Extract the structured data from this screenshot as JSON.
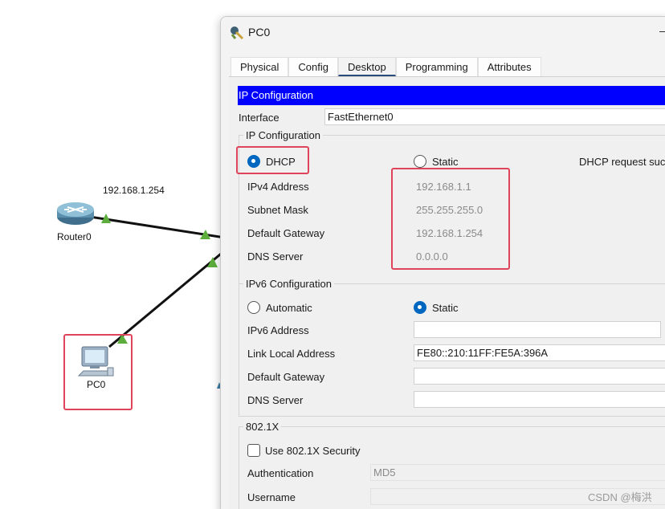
{
  "topology": {
    "router_label": "Router0",
    "router_ip_label": "192.168.1.254",
    "pc_label": "PC0",
    "link_color": "#111111",
    "link_light_color": "#5cad3c",
    "highlight_color": "#e0445a"
  },
  "window": {
    "title": "PC0",
    "tabs": [
      {
        "label": "Physical",
        "active": false
      },
      {
        "label": "Config",
        "active": false
      },
      {
        "label": "Desktop",
        "active": true
      },
      {
        "label": "Programming",
        "active": false
      },
      {
        "label": "Attributes",
        "active": false
      }
    ]
  },
  "ip_config": {
    "header": "IP Configuration",
    "interface_label": "Interface",
    "interface_value": "FastEthernet0",
    "ipv4": {
      "group_title": "IP Configuration",
      "dhcp_label": "DHCP",
      "static_label": "Static",
      "mode": "DHCP",
      "status_text": "DHCP request suc",
      "fields": [
        {
          "label": "IPv4 Address",
          "value": "192.168.1.1"
        },
        {
          "label": "Subnet Mask",
          "value": "255.255.255.0"
        },
        {
          "label": "Default Gateway",
          "value": "192.168.1.254"
        },
        {
          "label": "DNS Server",
          "value": "0.0.0.0"
        }
      ]
    },
    "ipv6": {
      "group_title": "IPv6 Configuration",
      "automatic_label": "Automatic",
      "static_label": "Static",
      "mode": "Static",
      "fields": [
        {
          "label": "IPv6 Address",
          "value": ""
        },
        {
          "label": "Link Local Address",
          "value": "FE80::210:11FF:FE5A:396A"
        },
        {
          "label": "Default Gateway",
          "value": ""
        },
        {
          "label": "DNS Server",
          "value": ""
        }
      ]
    },
    "dot1x": {
      "group_title": "802.1X",
      "use_security_label": "Use 802.1X Security",
      "use_security_checked": false,
      "authentication_label": "Authentication",
      "authentication_value": "MD5",
      "username_label": "Username",
      "username_value": ""
    }
  },
  "watermark": "CSDN @梅洪",
  "colors": {
    "header_blue": "#0000ff",
    "radio_accent": "#0067c0",
    "highlight_red": "#e0445a"
  }
}
